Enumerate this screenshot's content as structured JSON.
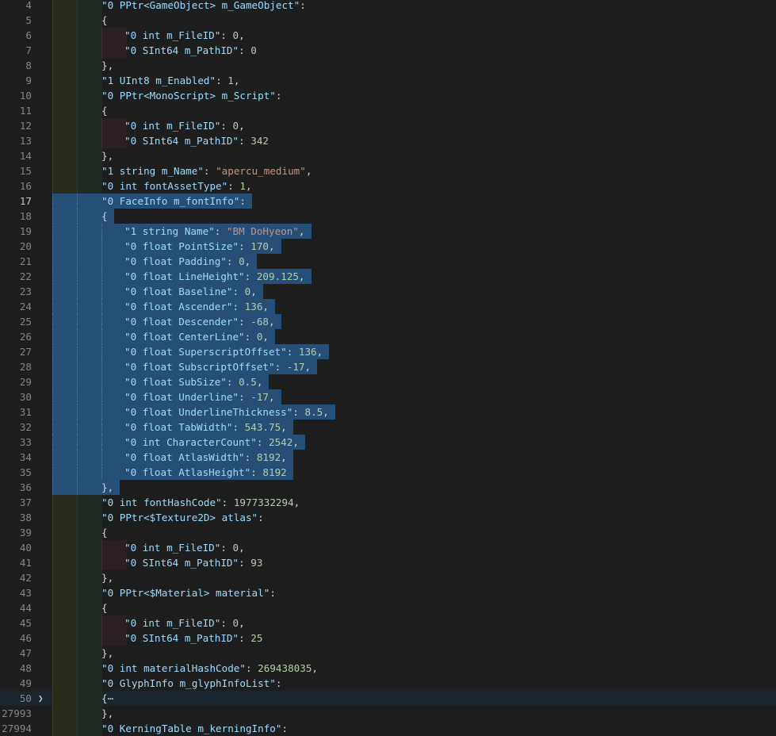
{
  "editor": {
    "active_line": "17",
    "lines": [
      {
        "no": "4",
        "depth": 2,
        "key": "\"0 PPtr<GameObject> m_GameObject\"",
        "sep": ":",
        "val": "",
        "vtype": "",
        "tail": ""
      },
      {
        "no": "5",
        "depth": 2,
        "key": "",
        "sep": "",
        "val": "",
        "vtype": "",
        "tail": "{"
      },
      {
        "no": "6",
        "depth": 3,
        "key": "\"0 int m_FileID\"",
        "sep": ": ",
        "val": "0",
        "vtype": "n",
        "tail": ","
      },
      {
        "no": "7",
        "depth": 3,
        "key": "\"0 SInt64 m_PathID\"",
        "sep": ": ",
        "val": "0",
        "vtype": "n",
        "tail": ""
      },
      {
        "no": "8",
        "depth": 2,
        "key": "",
        "sep": "",
        "val": "",
        "vtype": "",
        "tail": "},"
      },
      {
        "no": "9",
        "depth": 2,
        "key": "\"1 UInt8 m_Enabled\"",
        "sep": ": ",
        "val": "1",
        "vtype": "n",
        "tail": ","
      },
      {
        "no": "10",
        "depth": 2,
        "key": "\"0 PPtr<MonoScript> m_Script\"",
        "sep": ":",
        "val": "",
        "vtype": "",
        "tail": ""
      },
      {
        "no": "11",
        "depth": 2,
        "key": "",
        "sep": "",
        "val": "",
        "vtype": "",
        "tail": "{"
      },
      {
        "no": "12",
        "depth": 3,
        "key": "\"0 int m_FileID\"",
        "sep": ": ",
        "val": "0",
        "vtype": "n",
        "tail": ","
      },
      {
        "no": "13",
        "depth": 3,
        "key": "\"0 SInt64 m_PathID\"",
        "sep": ": ",
        "val": "342",
        "vtype": "n",
        "tail": ""
      },
      {
        "no": "14",
        "depth": 2,
        "key": "",
        "sep": "",
        "val": "",
        "vtype": "",
        "tail": "},"
      },
      {
        "no": "15",
        "depth": 2,
        "key": "\"1 string m_Name\"",
        "sep": ": ",
        "val": "\"apercu_medium\"",
        "vtype": "s",
        "tail": ","
      },
      {
        "no": "16",
        "depth": 2,
        "key": "\"0 int fontAssetType\"",
        "sep": ": ",
        "val": "1",
        "vtype": "n",
        "tail": ","
      },
      {
        "no": "17",
        "depth": 2,
        "key": "\"0 FaceInfo m_fontInfo\"",
        "sep": ":",
        "val": "",
        "vtype": "",
        "tail": "",
        "sel": true
      },
      {
        "no": "18",
        "depth": 2,
        "key": "",
        "sep": "",
        "val": "",
        "vtype": "",
        "tail": "{",
        "sel": true
      },
      {
        "no": "19",
        "depth": 3,
        "key": "\"1 string Name\"",
        "sep": ": ",
        "val": "\"BM DoHyeon\"",
        "vtype": "s",
        "tail": ",",
        "sel": true
      },
      {
        "no": "20",
        "depth": 3,
        "key": "\"0 float PointSize\"",
        "sep": ": ",
        "val": "170",
        "vtype": "n",
        "tail": ",",
        "sel": true
      },
      {
        "no": "21",
        "depth": 3,
        "key": "\"0 float Padding\"",
        "sep": ": ",
        "val": "0",
        "vtype": "n",
        "tail": ",",
        "sel": true
      },
      {
        "no": "22",
        "depth": 3,
        "key": "\"0 float LineHeight\"",
        "sep": ": ",
        "val": "209.125",
        "vtype": "n",
        "tail": ",",
        "sel": true
      },
      {
        "no": "23",
        "depth": 3,
        "key": "\"0 float Baseline\"",
        "sep": ": ",
        "val": "0",
        "vtype": "n",
        "tail": ",",
        "sel": true
      },
      {
        "no": "24",
        "depth": 3,
        "key": "\"0 float Ascender\"",
        "sep": ": ",
        "val": "136",
        "vtype": "n",
        "tail": ",",
        "sel": true
      },
      {
        "no": "25",
        "depth": 3,
        "key": "\"0 float Descender\"",
        "sep": ": ",
        "val": "-68",
        "vtype": "n",
        "tail": ",",
        "sel": true
      },
      {
        "no": "26",
        "depth": 3,
        "key": "\"0 float CenterLine\"",
        "sep": ": ",
        "val": "0",
        "vtype": "n",
        "tail": ",",
        "sel": true
      },
      {
        "no": "27",
        "depth": 3,
        "key": "\"0 float SuperscriptOffset\"",
        "sep": ": ",
        "val": "136",
        "vtype": "n",
        "tail": ",",
        "sel": true
      },
      {
        "no": "28",
        "depth": 3,
        "key": "\"0 float SubscriptOffset\"",
        "sep": ": ",
        "val": "-17",
        "vtype": "n",
        "tail": ",",
        "sel": true
      },
      {
        "no": "29",
        "depth": 3,
        "key": "\"0 float SubSize\"",
        "sep": ": ",
        "val": "0.5",
        "vtype": "n",
        "tail": ",",
        "sel": true
      },
      {
        "no": "30",
        "depth": 3,
        "key": "\"0 float Underline\"",
        "sep": ": ",
        "val": "-17",
        "vtype": "n",
        "tail": ",",
        "sel": true
      },
      {
        "no": "31",
        "depth": 3,
        "key": "\"0 float UnderlineThickness\"",
        "sep": ": ",
        "val": "8.5",
        "vtype": "n",
        "tail": ",",
        "sel": true
      },
      {
        "no": "32",
        "depth": 3,
        "key": "\"0 float TabWidth\"",
        "sep": ": ",
        "val": "543.75",
        "vtype": "n",
        "tail": ",",
        "sel": true
      },
      {
        "no": "33",
        "depth": 3,
        "key": "\"0 int CharacterCount\"",
        "sep": ": ",
        "val": "2542",
        "vtype": "n",
        "tail": ",",
        "sel": true
      },
      {
        "no": "34",
        "depth": 3,
        "key": "\"0 float AtlasWidth\"",
        "sep": ": ",
        "val": "8192",
        "vtype": "n",
        "tail": ",",
        "sel": true
      },
      {
        "no": "35",
        "depth": 3,
        "key": "\"0 float AtlasHeight\"",
        "sep": ": ",
        "val": "8192",
        "vtype": "n",
        "tail": "",
        "sel": true
      },
      {
        "no": "36",
        "depth": 2,
        "key": "",
        "sep": "",
        "val": "",
        "vtype": "",
        "tail": "},",
        "sel": true
      },
      {
        "no": "37",
        "depth": 2,
        "key": "\"0 int fontHashCode\"",
        "sep": ": ",
        "val": "1977332294",
        "vtype": "n",
        "tail": ","
      },
      {
        "no": "38",
        "depth": 2,
        "key": "\"0 PPtr<$Texture2D> atlas\"",
        "sep": ":",
        "val": "",
        "vtype": "",
        "tail": ""
      },
      {
        "no": "39",
        "depth": 2,
        "key": "",
        "sep": "",
        "val": "",
        "vtype": "",
        "tail": "{"
      },
      {
        "no": "40",
        "depth": 3,
        "key": "\"0 int m_FileID\"",
        "sep": ": ",
        "val": "0",
        "vtype": "n",
        "tail": ","
      },
      {
        "no": "41",
        "depth": 3,
        "key": "\"0 SInt64 m_PathID\"",
        "sep": ": ",
        "val": "93",
        "vtype": "n",
        "tail": ""
      },
      {
        "no": "42",
        "depth": 2,
        "key": "",
        "sep": "",
        "val": "",
        "vtype": "",
        "tail": "},"
      },
      {
        "no": "43",
        "depth": 2,
        "key": "\"0 PPtr<$Material> material\"",
        "sep": ":",
        "val": "",
        "vtype": "",
        "tail": ""
      },
      {
        "no": "44",
        "depth": 2,
        "key": "",
        "sep": "",
        "val": "",
        "vtype": "",
        "tail": "{"
      },
      {
        "no": "45",
        "depth": 3,
        "key": "\"0 int m_FileID\"",
        "sep": ": ",
        "val": "0",
        "vtype": "n",
        "tail": ","
      },
      {
        "no": "46",
        "depth": 3,
        "key": "\"0 SInt64 m_PathID\"",
        "sep": ": ",
        "val": "25",
        "vtype": "n",
        "tail": ""
      },
      {
        "no": "47",
        "depth": 2,
        "key": "",
        "sep": "",
        "val": "",
        "vtype": "",
        "tail": "},"
      },
      {
        "no": "48",
        "depth": 2,
        "key": "\"0 int materialHashCode\"",
        "sep": ": ",
        "val": "269438035",
        "vtype": "n",
        "tail": ","
      },
      {
        "no": "49",
        "depth": 2,
        "key": "\"0 GlyphInfo m_glyphInfoList\"",
        "sep": ":",
        "val": "",
        "vtype": "",
        "tail": ""
      },
      {
        "no": "50",
        "depth": 2,
        "key": "",
        "sep": "",
        "val": "",
        "vtype": "",
        "tail": "{",
        "folded": true,
        "ellipsis": "⋯"
      },
      {
        "no": "27993",
        "depth": 2,
        "key": "",
        "sep": "",
        "val": "",
        "vtype": "",
        "tail": "},"
      },
      {
        "no": "27994",
        "depth": 2,
        "key": "\"0 KerningTable m_kerningInfo\"",
        "sep": ":",
        "val": "",
        "vtype": "",
        "tail": ""
      }
    ]
  },
  "colors": {
    "background": "#1e1e1e",
    "selection": "#264f78",
    "key": "#9cdcfe",
    "string": "#ce9178",
    "number": "#b5cea8"
  },
  "icons": {
    "fold_collapsed": "chevron-right-icon"
  }
}
